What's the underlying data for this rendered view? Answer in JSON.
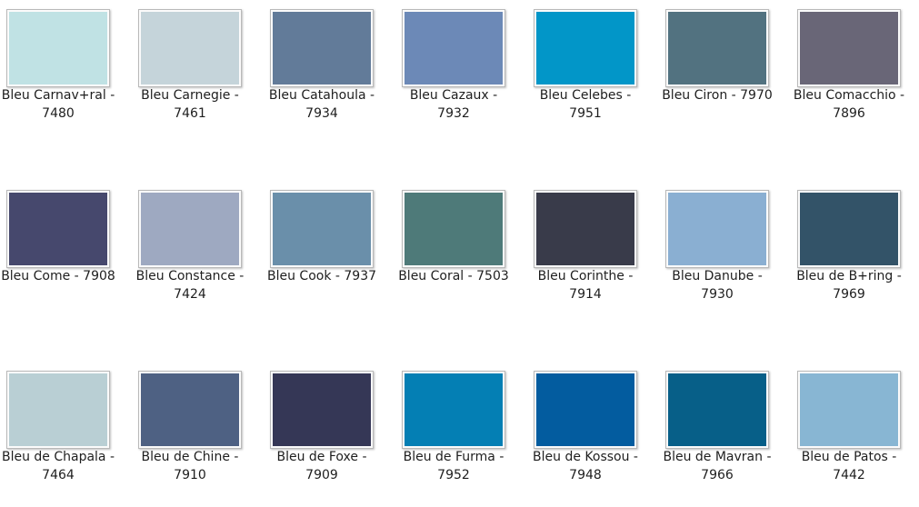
{
  "items": [
    {
      "label": "Bleu Carnav+ral - 7480",
      "color": "#c0e2e4"
    },
    {
      "label": "Bleu Carnegie - 7461",
      "color": "#c5d4da"
    },
    {
      "label": "Bleu Catahoula - 7934",
      "color": "#627b99"
    },
    {
      "label": "Bleu Cazaux - 7932",
      "color": "#6c89b7"
    },
    {
      "label": "Bleu Celebes - 7951",
      "color": "#0296c8"
    },
    {
      "label": "Bleu Ciron - 7970",
      "color": "#527280"
    },
    {
      "label": "Bleu Comacchio - 7896",
      "color": "#696677"
    },
    {
      "label": "Bleu Come - 7908",
      "color": "#46486d"
    },
    {
      "label": "Bleu Constance - 7424",
      "color": "#9ea9c1"
    },
    {
      "label": "Bleu Cook - 7937",
      "color": "#6a8faa"
    },
    {
      "label": "Bleu Coral - 7503",
      "color": "#4e7a79"
    },
    {
      "label": "Bleu Corinthe - 7914",
      "color": "#393b4a"
    },
    {
      "label": "Bleu Danube - 7930",
      "color": "#8aafd2"
    },
    {
      "label": "Bleu de B+ring - 7969",
      "color": "#335368"
    },
    {
      "label": "Bleu de Chapala - 7464",
      "color": "#b9cfd4"
    },
    {
      "label": "Bleu de Chine - 7910",
      "color": "#4e6183"
    },
    {
      "label": "Bleu de Foxe - 7909",
      "color": "#353756"
    },
    {
      "label": "Bleu de Furma - 7952",
      "color": "#047fb4"
    },
    {
      "label": "Bleu de Kossou - 7948",
      "color": "#035c9f"
    },
    {
      "label": "Bleu de Mavran - 7966",
      "color": "#075f88"
    },
    {
      "label": "Bleu de Patos - 7442",
      "color": "#88b6d3"
    }
  ]
}
